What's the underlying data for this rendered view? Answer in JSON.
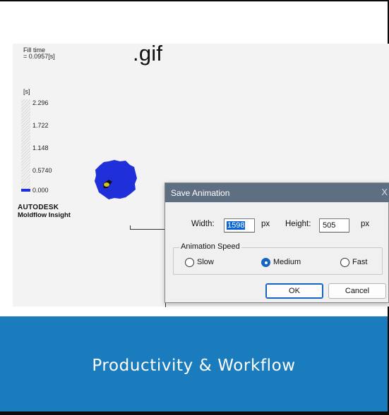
{
  "header": {
    "file_ext_label": ".gif"
  },
  "result_view": {
    "fill_time_title": "Fill time",
    "fill_time_value": "= 0.0957[s]",
    "legend": {
      "unit": "[s]",
      "ticks": [
        "2.296",
        "1.722",
        "1.148",
        "0.5740",
        "0.000"
      ],
      "low_color": "#1f2fd9"
    },
    "branding": {
      "line1": "AUTODESK",
      "line2": "Moldflow Insight"
    },
    "part_color": "#1f2fd9"
  },
  "dialog": {
    "title": "Save Animation",
    "close_glyph": "X",
    "width_label": "Width:",
    "width_value": "1598",
    "width_unit": "px",
    "height_label": "Height:",
    "height_value": "505",
    "height_unit": "px",
    "speed_group_label": "Animation Speed",
    "speed_options": [
      {
        "label": "Slow",
        "selected": false
      },
      {
        "label": "Medium",
        "selected": true
      },
      {
        "label": "Fast",
        "selected": false
      }
    ],
    "ok_label": "OK",
    "cancel_label": "Cancel"
  },
  "banner": {
    "text": "Productivity & Workflow",
    "color": "#1a7cbd"
  }
}
